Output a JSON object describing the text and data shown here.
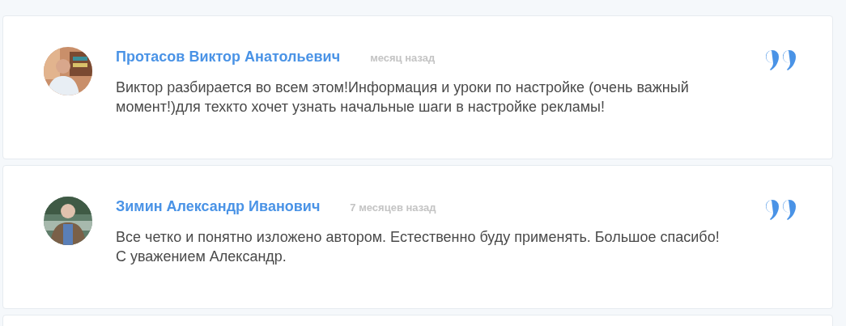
{
  "reviews": [
    {
      "author": "Протасов Виктор Анатольевич",
      "time": "месяц назад",
      "text": "Виктор разбирается во всем этом!Информация и уроки по настройке (очень важный момент!)для техкто хочет узнать начальные шаги в настройке рекламы!"
    },
    {
      "author": "Зимин Александр Иванович",
      "time": "7 месяцев назад",
      "text": "Все четко и понятно изложено автором. Естественно буду применять. Большое спасибо!\nС уважением Александр."
    }
  ]
}
